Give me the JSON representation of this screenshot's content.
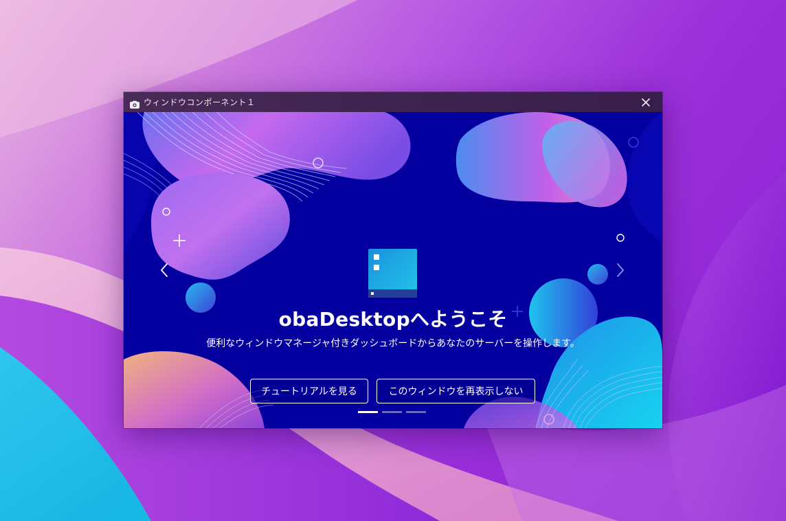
{
  "window": {
    "title": "ウィンドウコンポーネント１"
  },
  "welcome": {
    "title": "obaDesktopへようこそ",
    "description": "便利なウィンドウマネージャ付きダッシュボードからあなたのサーバーを操作します。"
  },
  "buttons": {
    "tutorial": "チュートリアルを見る",
    "hide": "このウィンドウを再表示しない"
  },
  "carousel": {
    "slide_count": 3,
    "active_index": 0
  },
  "colors": {
    "titlebar": "#3f2450",
    "content_bg": "#0400a0",
    "icon_tile": "#1aa8d6",
    "text": "#ffffff"
  },
  "icons": {
    "app": "camera-icon",
    "close": "close-icon",
    "prev": "chevron-left-icon",
    "next": "chevron-right-icon",
    "hero": "desktop-app-icon"
  }
}
